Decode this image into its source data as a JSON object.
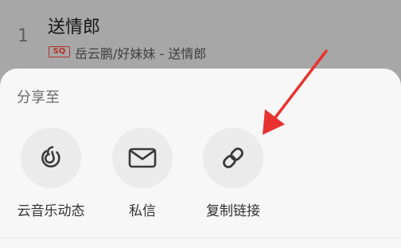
{
  "song": {
    "index": "1",
    "title": "送情郎",
    "badge": "SQ",
    "meta": "岳云鹏/好妹妹 - 送情郎"
  },
  "share_sheet": {
    "title": "分享至",
    "options": [
      {
        "label": "云音乐动态",
        "icon": "cloud-music-icon"
      },
      {
        "label": "私信",
        "icon": "envelope-icon"
      },
      {
        "label": "复制链接",
        "icon": "link-icon"
      }
    ]
  },
  "colors": {
    "overlay": "#a7a7a7",
    "sheet": "#f7f7f7",
    "icon_circle": "#ebebeb",
    "badge_red": "#b5312b",
    "annotation_arrow": "#e8322f"
  }
}
